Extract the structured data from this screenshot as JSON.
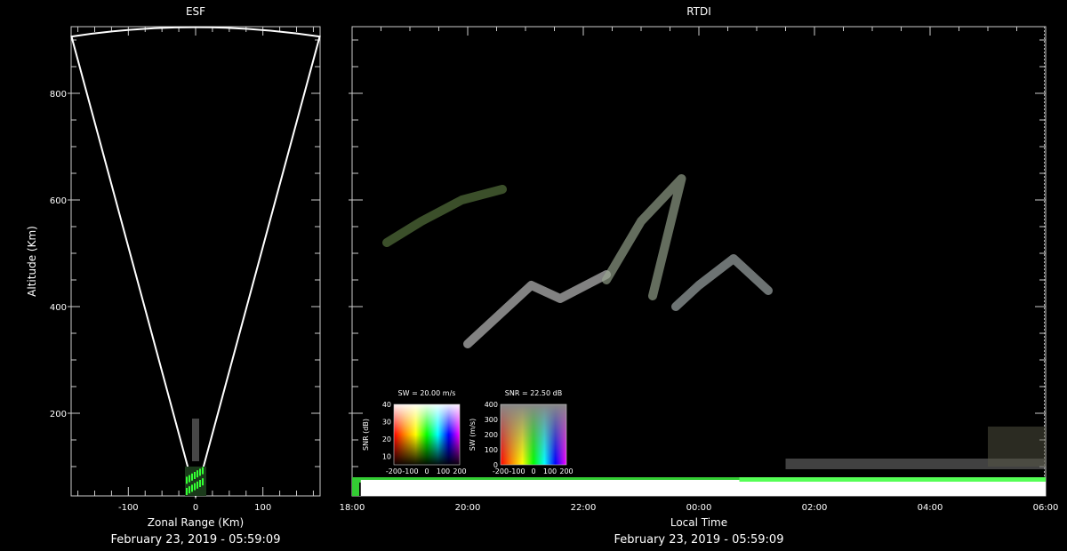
{
  "chart_data": [
    {
      "type": "scatter",
      "title": "ESF",
      "xlabel": "Zonal Range (Km)",
      "ylabel": "Altitude (Km)",
      "subtitle": "February 23, 2019 - 05:59:09",
      "xlim": [
        -185,
        185
      ],
      "ylim": [
        45,
        925
      ],
      "x_ticks": [
        -100,
        0,
        100
      ],
      "y_ticks": [
        200,
        400,
        600,
        800
      ],
      "beam_half_angle_deg": 11.5,
      "beam_max_range_km": 925
    },
    {
      "type": "heatmap",
      "title": "RTDI",
      "xlabel": "Local Time",
      "subtitle": "February 23, 2019 - 05:59:09",
      "x_tick_labels": [
        "18:00",
        "20:00",
        "22:00",
        "00:00",
        "02:00",
        "04:00",
        "06:00"
      ],
      "x_hours": [
        -6,
        18
      ],
      "ylim": [
        45,
        925
      ],
      "y_ticks": [
        200,
        400,
        600,
        800
      ],
      "plumes": [
        {
          "name": "plume-1",
          "points": [
            [
              2.0,
              330
            ],
            [
              3.1,
              440
            ],
            [
              3.6,
              415
            ],
            [
              4.4,
              460
            ]
          ],
          "color": "#c8c8c8"
        },
        {
          "name": "plume-2",
          "points": [
            [
              4.4,
              450
            ],
            [
              5.0,
              560
            ],
            [
              5.7,
              640
            ],
            [
              5.2,
              420
            ]
          ],
          "color": "#9aa890"
        },
        {
          "name": "plume-3",
          "points": [
            [
              5.6,
              400
            ],
            [
              6.0,
              440
            ],
            [
              6.6,
              490
            ],
            [
              7.2,
              430
            ]
          ],
          "color": "#a8b0b0"
        },
        {
          "name": "plume-4",
          "points": [
            [
              0.6,
              520
            ],
            [
              1.2,
              560
            ],
            [
              1.9,
              600
            ],
            [
              2.6,
              620
            ]
          ],
          "color": "#5a7a40"
        }
      ],
      "legends": [
        {
          "title": "SW = 20.00 m/s",
          "ylabel": "SNR (dB)",
          "y_ticks": [
            10,
            20,
            30,
            40
          ],
          "x_ticks": [
            "-200",
            "-100",
            "0",
            "100",
            "200"
          ]
        },
        {
          "title": "SNR = 22.50 dB",
          "ylabel": "SW (m/s)",
          "y_ticks": [
            0,
            100,
            200,
            300,
            400
          ],
          "x_ticks": [
            "-200",
            "-100",
            "0",
            "100",
            "200"
          ]
        }
      ]
    }
  ]
}
